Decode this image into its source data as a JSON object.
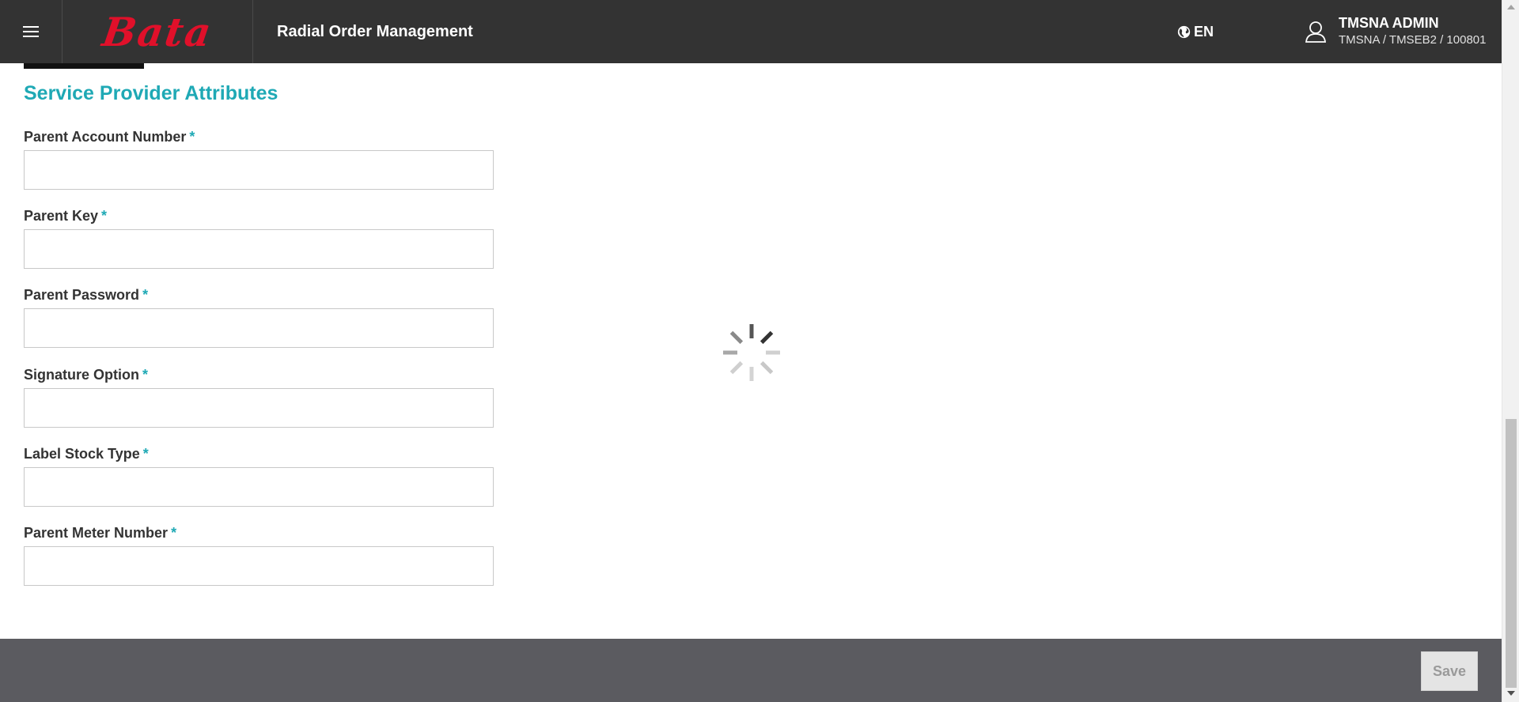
{
  "header": {
    "logo_text": "Bata",
    "app_title": "Radial Order Management",
    "language": "EN",
    "user_name": "TMSNA ADMIN",
    "user_org": "TMSNA / TMSEB2 / 100801",
    "icons": {
      "menu": "hamburger-menu-icon",
      "language": "globe-icon",
      "user": "user-icon"
    }
  },
  "section": {
    "title": "Service Provider Attributes"
  },
  "fields": [
    {
      "label": "Parent Account Number",
      "required_mark": "*",
      "value": ""
    },
    {
      "label": "Parent Key",
      "required_mark": "*",
      "value": ""
    },
    {
      "label": "Parent Password",
      "required_mark": "*",
      "value": ""
    },
    {
      "label": "Signature Option",
      "required_mark": "*",
      "value": ""
    },
    {
      "label": "Label Stock Type",
      "required_mark": "*",
      "value": ""
    },
    {
      "label": "Parent Meter Number",
      "required_mark": "*",
      "value": ""
    }
  ],
  "footer": {
    "save_label": "Save"
  },
  "loading": {
    "icon": "loading-spinner-icon"
  },
  "colors": {
    "header_bg": "#333333",
    "accent": "#1fa9b5",
    "brand_red": "#e0102a",
    "footer_bg": "#5b5b60"
  }
}
